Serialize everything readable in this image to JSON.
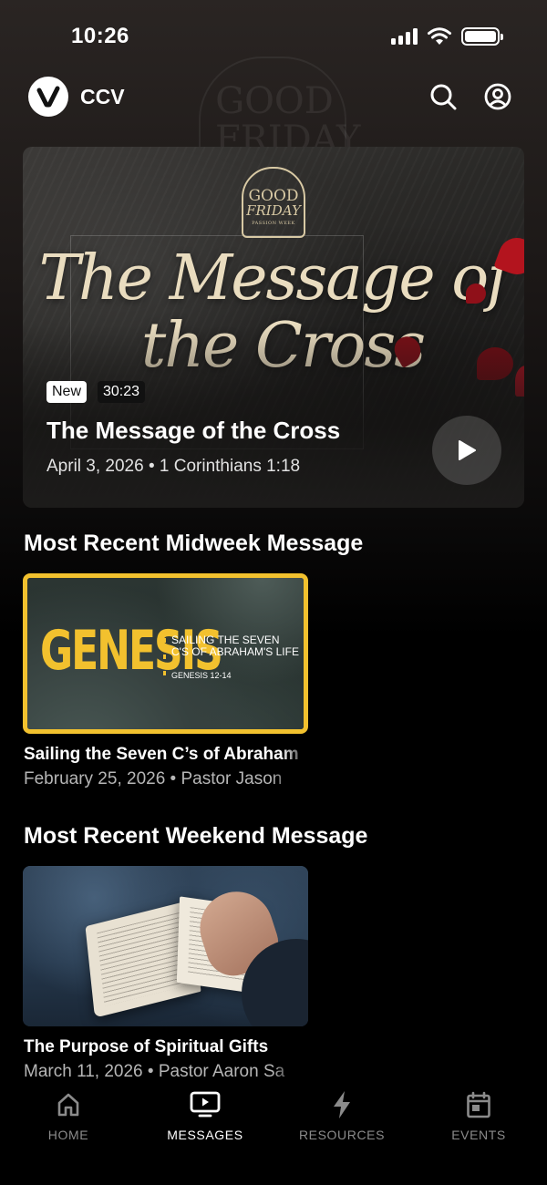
{
  "status_bar": {
    "time": "10:26"
  },
  "header": {
    "brand": "CCV"
  },
  "background_art": {
    "text": "GOOD FRIDAY"
  },
  "hero": {
    "art": {
      "badge_line1": "GOOD",
      "badge_line2": "FRIDAY",
      "badge_line3": "PASSION WEEK",
      "title_line1": "The Message of",
      "title_line2": "the Cross"
    },
    "tag_new": "New",
    "duration": "30:23",
    "title": "The Message of the Cross",
    "meta": "April 3, 2026 • 1 Corinthians 1:18"
  },
  "midweek": {
    "section_title": "Most Recent Midweek Message",
    "art": {
      "word": "GENESIS",
      "subtitle": "SAILING THE SEVEN C'S OF ABRAHAM'S LIFE",
      "reference": "GENESIS 12-14"
    },
    "title": "Sailing the Seven C’s of Abraham",
    "meta": "February 25, 2026 • Pastor Jason"
  },
  "weekend": {
    "section_title": "Most Recent Weekend Message",
    "title": "The Purpose of Spiritual Gifts",
    "meta": "March 11, 2026 • Pastor Aaron Sa"
  },
  "tabs": [
    {
      "label": "HOME",
      "icon": "home-icon",
      "active": false
    },
    {
      "label": "MESSAGES",
      "icon": "tv-play-icon",
      "active": true
    },
    {
      "label": "RESOURCES",
      "icon": "bolt-icon",
      "active": false
    },
    {
      "label": "EVENTS",
      "icon": "calendar-icon",
      "active": false
    }
  ],
  "colors": {
    "accent_yellow": "#f2c12e",
    "text_secondary": "#b6b6b6",
    "tab_inactive": "#8b8b8b"
  }
}
